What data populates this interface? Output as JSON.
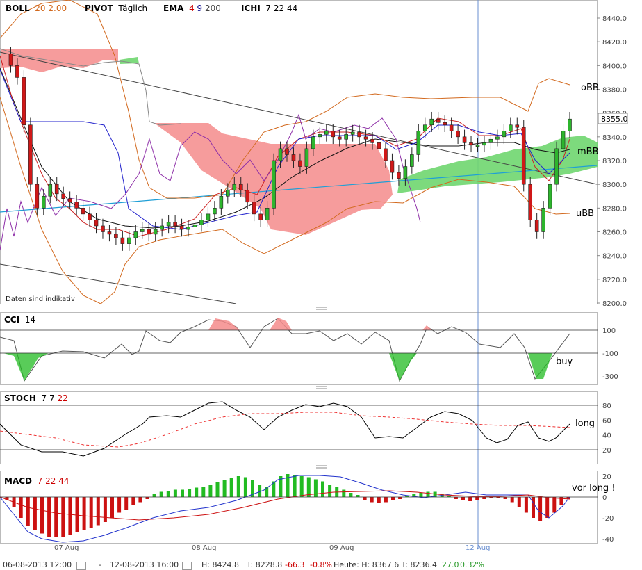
{
  "header": {
    "boll": {
      "name": "BOLL",
      "p1": "20",
      "p2": "2.00",
      "color": "#d2691e"
    },
    "pivot": {
      "name": "PIVOT",
      "p1": "Täglich"
    },
    "ema": {
      "name": "EMA",
      "p1": "4",
      "p2": "9",
      "p3": "200",
      "c1": "#cc0000",
      "c2": "#00008b",
      "c3": "#444"
    },
    "ichi": {
      "name": "ICHI",
      "p1": "7",
      "p2": "22",
      "p3": "44"
    }
  },
  "indicator_labels": {
    "cci": {
      "name": "CCI",
      "p1": "14"
    },
    "stoch": {
      "name": "STOCH",
      "p1": "7",
      "p2": "7",
      "p3": "22"
    },
    "macd": {
      "name": "MACD",
      "p1": "7",
      "p2": "22",
      "p3": "44"
    }
  },
  "annotations": {
    "obb": "oBB",
    "mbb": "mBB",
    "ubb": "uBB",
    "buy": "buy",
    "long": "long",
    "vor_long": "vor long !",
    "indicative": "Daten sind indikativ"
  },
  "footer": {
    "from": "06-08-2013 12:00",
    "sep": "-",
    "to": "12-08-2013 16:00",
    "h": "H: 8424.8",
    "t": "T: 8228.8",
    "chg": "-66.3",
    "pct": "-0.8%",
    "today": "Heute: H: 8367.6  T: 8236.4",
    "today_chg": "27.0",
    "today_pct": "0.32%"
  },
  "chart_data": {
    "type": "line",
    "x_labels": [
      "07 Aug",
      "08 Aug",
      "09 Aug",
      "12 Aug"
    ],
    "last_price": "8355.0",
    "price_axis": {
      "ticks": [
        8200.0,
        8220.0,
        8240.0,
        8260.0,
        8280.0,
        8300.0,
        8320.0,
        8340.0,
        8360.0,
        8380.0,
        8400.0,
        8420.0,
        8440.0
      ],
      "ylim": [
        8200,
        8450
      ]
    },
    "cci_axis": {
      "ticks": [
        100,
        -100,
        -300
      ]
    },
    "stoch_axis": {
      "ticks": [
        80,
        60,
        40,
        20
      ]
    },
    "macd_axis": {
      "ticks": [
        20,
        0,
        -20,
        -40
      ]
    },
    "price_close": [
      8410,
      8400,
      8390,
      8350,
      8300,
      8280,
      8290,
      8300,
      8292,
      8288,
      8285,
      8280,
      8275,
      8270,
      8265,
      8260,
      8258,
      8255,
      8250,
      8255,
      8260,
      8262,
      8258,
      8262,
      8265,
      8268,
      8265,
      8262,
      8264,
      8266,
      8270,
      8275,
      8280,
      8290,
      8295,
      8300,
      8295,
      8285,
      8275,
      8270,
      8280,
      8320,
      8330,
      8325,
      8320,
      8315,
      8330,
      8340,
      8342,
      8345,
      8340,
      8338,
      8342,
      8344,
      8340,
      8338,
      8335,
      8330,
      8320,
      8310,
      8305,
      8315,
      8325,
      8345,
      8350,
      8355,
      8352,
      8350,
      8345,
      8340,
      8335,
      8333,
      8333,
      8335,
      8338,
      8340,
      8345,
      8350,
      8348,
      8300,
      8270,
      8260,
      8280,
      8300,
      8330,
      8345,
      8355
    ],
    "colors": {
      "bull": "#2db52d",
      "bear": "#d01818",
      "boll": "#d2691e",
      "ema4": "#cc2222",
      "ema9": "#2222cc",
      "ema200": "#111111",
      "cloud_bear": "#f58b8b",
      "cloud_bull": "#6fd66f",
      "ichi_purple": "#8e2fa8",
      "trend": "#1f9fd6",
      "cci_line": "#555555",
      "macd_line": "#2233cc",
      "macd_signal": "#cc1111",
      "macd_pos": "#22bb22",
      "macd_neg": "#cc1111",
      "stoch_k": "#000000",
      "stoch_d": "#ee3333"
    }
  }
}
